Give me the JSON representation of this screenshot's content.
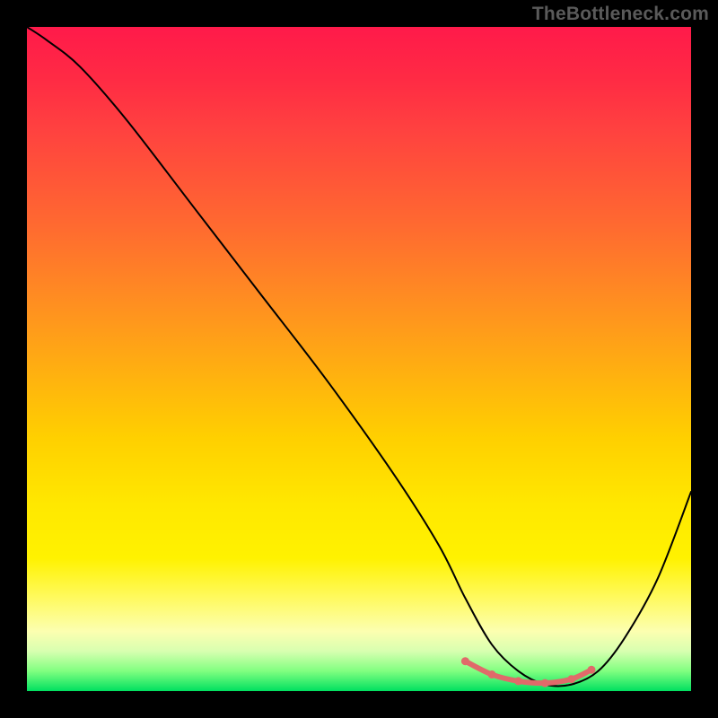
{
  "watermark": "TheBottleneck.com",
  "chart_data": {
    "type": "line",
    "title": "",
    "xlabel": "",
    "ylabel": "",
    "xlim": [
      0,
      100
    ],
    "ylim": [
      0,
      100
    ],
    "grid": false,
    "legend": false,
    "series": [
      {
        "name": "bottleneck-curve",
        "x": [
          0,
          3,
          8,
          15,
          25,
          35,
          45,
          55,
          62,
          66,
          70,
          74,
          78,
          82,
          86,
          90,
          95,
          100
        ],
        "y": [
          100,
          98,
          94,
          86,
          73,
          60,
          47,
          33,
          22,
          14,
          7,
          3,
          1,
          1,
          3,
          8,
          17,
          30
        ]
      }
    ],
    "highlight_region": {
      "name": "optimal-zone",
      "x": [
        66,
        70,
        74,
        78,
        82,
        85
      ],
      "y": [
        4.5,
        2.5,
        1.5,
        1.2,
        1.8,
        3.2
      ]
    },
    "background_gradient": {
      "stops": [
        {
          "pos": 0,
          "color": "#ff1a4a"
        },
        {
          "pos": 30,
          "color": "#ff6a30"
        },
        {
          "pos": 62,
          "color": "#ffd000"
        },
        {
          "pos": 86,
          "color": "#fffa60"
        },
        {
          "pos": 97,
          "color": "#80ff80"
        },
        {
          "pos": 100,
          "color": "#00e060"
        }
      ]
    }
  }
}
